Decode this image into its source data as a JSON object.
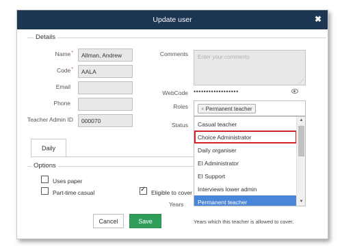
{
  "dialog": {
    "title": "Update user",
    "close_glyph": "✖"
  },
  "details": {
    "legend": "Details",
    "name": {
      "label": "Name",
      "value": "Allman, Andrew"
    },
    "code": {
      "label": "Code",
      "value": "AALA"
    },
    "email": {
      "label": "Email",
      "value": ""
    },
    "phone": {
      "label": "Phone",
      "value": ""
    },
    "teacher_admin_id": {
      "label": "Teacher Admin ID",
      "value": "000070"
    },
    "required_marker": "*",
    "comments": {
      "label": "Comments",
      "placeholder": "Enter your comments"
    },
    "webcode": {
      "label": "WebCode",
      "value": "••••••••••••••••••"
    },
    "roles": {
      "label": "Roles",
      "selected_tag": "Permanent teacher",
      "remove_glyph": "×"
    },
    "status": {
      "label": "Status"
    }
  },
  "roles_dropdown": {
    "options": [
      "Casual teacher",
      "Choice Administrator",
      "Daily organiser",
      "EI Administrator",
      "EI Support",
      "Interviews lower admin",
      "Permanent teacher"
    ],
    "highlighted": "Choice Administrator",
    "selected": "Permanent teacher"
  },
  "tabs": [
    {
      "label": "Daily"
    }
  ],
  "options": {
    "legend": "Options",
    "uses_paper": {
      "label": "Uses paper",
      "checked": false
    },
    "part_time_casual": {
      "label": "Part-time casual",
      "checked": false
    },
    "eligible_to_cover": {
      "label": "Eligible to cover",
      "checked": true
    },
    "years": {
      "label": "Years",
      "help": "Years which this teacher is allowed to cover."
    }
  },
  "buttons": {
    "cancel": "Cancel",
    "save": "Save"
  },
  "colors": {
    "titlebar": "#1c3553",
    "save": "#2e9e58",
    "selected_option": "#4a86d8",
    "highlight_outline": "#d2232a"
  },
  "icons": {
    "close": "close-icon",
    "eye": "eye-icon",
    "resize": "resize-grip-icon",
    "scroll_up": "scroll-up-icon",
    "scroll_down": "scroll-down-icon"
  }
}
